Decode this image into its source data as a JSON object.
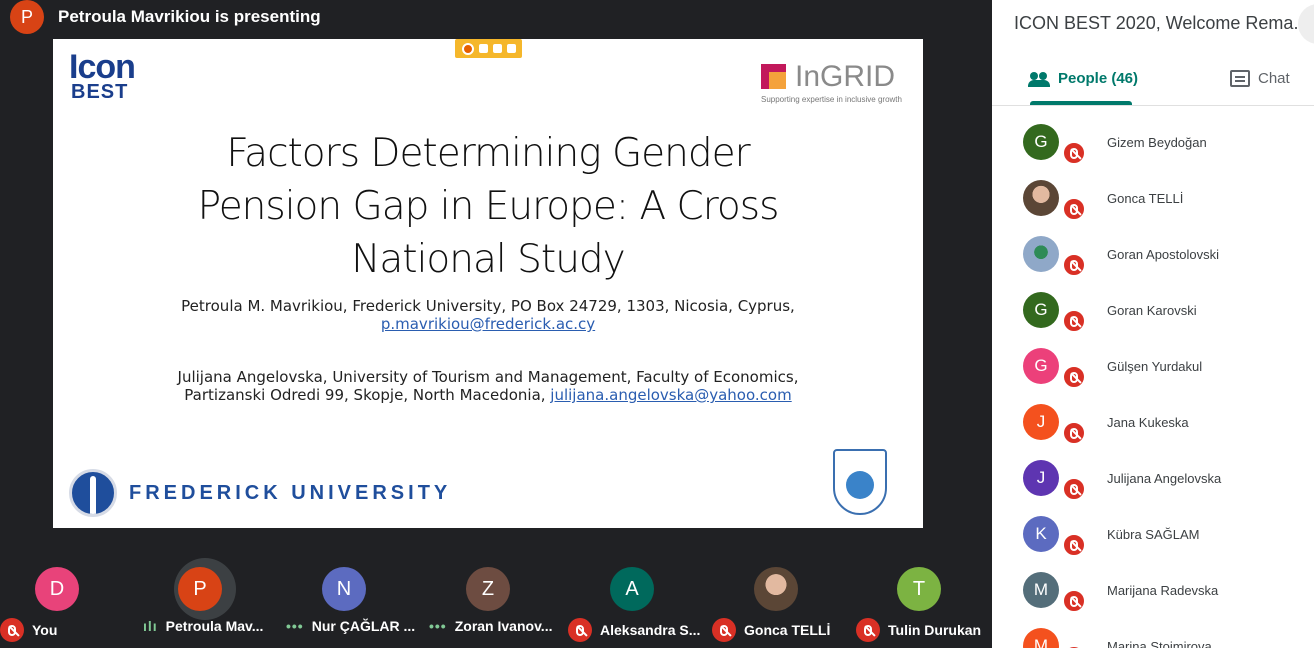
{
  "presenter": {
    "initial": "P",
    "text": "Petroula Mavrikiou is presenting",
    "color": "#d84315"
  },
  "slide": {
    "logo_left_line1": "Icon",
    "logo_left_line2": "BEST",
    "logo_right_word": "InGRID",
    "logo_right_tagline": "Supporting expertise in inclusive growth",
    "title_lines": [
      "Factors Determining Gender",
      "Pension Gap in Europe: A Cross",
      "National Study"
    ],
    "author1_line1": "Petroula M. Mavrikiou, Frederick University, PO Box 24729, 1303, Nicosia, Cyprus,",
    "author1_email": "p.mavrikiou@frederick.ac.cy",
    "author2_line1": "Julijana Angelovska, University of Tourism and Management, Faculty of Economics,",
    "author2_line2_prefix": "Partizanski Odredi 99, Skopje, North Macedonia, ",
    "author2_email": "julijana.angelovska@yahoo.com",
    "footer_logo_text": "FREDERICK UNIVERSITY"
  },
  "tiles": [
    {
      "initial": "D",
      "label": "You",
      "color": "#e8437a",
      "status": "muted"
    },
    {
      "initial": "P",
      "label": "Petroula Mav...",
      "color": "#d84315",
      "status": "speaking"
    },
    {
      "initial": "N",
      "label": "Nur ÇAĞLAR ...",
      "color": "#5c6bc0",
      "status": "active"
    },
    {
      "initial": "Z",
      "label": "Zoran Ivanov...",
      "color": "#6d4c41",
      "status": "active"
    },
    {
      "initial": "A",
      "label": "Aleksandra S...",
      "color": "#00695c",
      "status": "muted"
    },
    {
      "initial": "",
      "label": "Gonca TELLİ",
      "color": "#5b4636",
      "status": "muted"
    },
    {
      "initial": "T",
      "label": "Tulin Durukan",
      "color": "#7cb342",
      "status": "muted"
    }
  ],
  "panel": {
    "title": "ICON BEST 2020, Welcome Rema...",
    "tab_people": "People (46)",
    "tab_chat": "Chat",
    "people": [
      {
        "initial": "G",
        "name": "Gizem Beydoğan",
        "color": "#33691e"
      },
      {
        "initial": "",
        "name": "Gonca TELLİ",
        "color": "#5b4636",
        "photo": "photo"
      },
      {
        "initial": "",
        "name": "Goran Apostolovski",
        "color": "#8fa8c8",
        "photo": "photo2"
      },
      {
        "initial": "G",
        "name": "Goran Karovski",
        "color": "#33691e"
      },
      {
        "initial": "G",
        "name": "Gülşen Yurdakul",
        "color": "#ec407a"
      },
      {
        "initial": "J",
        "name": "Jana Kukeska",
        "color": "#f4511e"
      },
      {
        "initial": "J",
        "name": "Julijana Angelovska",
        "color": "#5e35b1"
      },
      {
        "initial": "K",
        "name": "Kübra SAĞLAM",
        "color": "#5c6bc0"
      },
      {
        "initial": "M",
        "name": "Marijana Radevska",
        "color": "#546e7a"
      },
      {
        "initial": "M",
        "name": "Marina Stojmirova",
        "color": "#f4511e"
      }
    ]
  }
}
